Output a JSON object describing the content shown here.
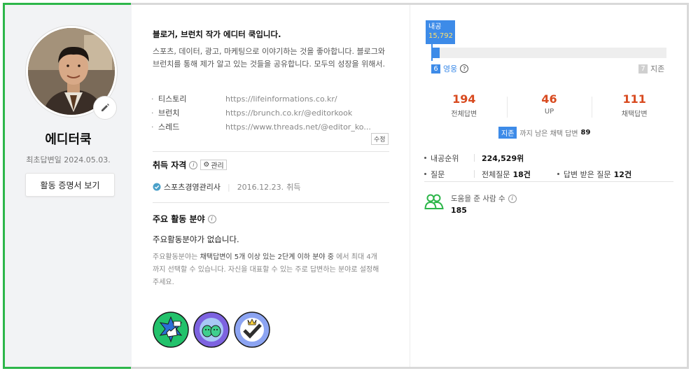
{
  "profile": {
    "nickname": "에디터쿡",
    "first_answer": "최초답변일 2024.05.03.",
    "cert_button": "활동 증명서 보기"
  },
  "bio": {
    "title": "블로거, 브런치 작가 에디터 쿡입니다.",
    "text": "스포츠, 데이터, 광고, 마케팅으로 이야기하는 것을 좋아합니다. 블로그와 브런치를 통해 제가 알고 있는 것들을 공유합니다. 모두의 성장을 위해서."
  },
  "links": [
    {
      "label": "티스토리",
      "url": "https://lifeinformations.co.kr/"
    },
    {
      "label": "브런치",
      "url": "https://brunch.co.kr/@editorkook"
    },
    {
      "label": "스레드",
      "url": "https://www.threads.net/@editor_ko..."
    }
  ],
  "edit_label": "수정",
  "qualification": {
    "title": "취득 자격",
    "manage": "관리",
    "name": "스포츠경영관리사",
    "date": "2016.12.23.",
    "status": "취득"
  },
  "area": {
    "title": "주요 활동 분야",
    "empty": "주요활동분야가 없습니다.",
    "help_pre": "주요활동분야는 ",
    "help_em": "채택답변이 5개 이상 있는 2단계 이하 분야 중",
    "help_post": " 에서 최대 4개까지 선택할 수 있습니다. 자신을 대표할 수 있는 주로 답변하는 분야로 설정해주세요."
  },
  "rank": {
    "flag_label": "내공",
    "flag_value": "15,792",
    "progress": 0.035,
    "current_level": "6",
    "current_name": "영웅",
    "next_level": "7",
    "next_name": "지존"
  },
  "stats": [
    {
      "value": "194",
      "label": "전체답변"
    },
    {
      "value": "46",
      "label": "UP"
    },
    {
      "value": "111",
      "label": "채택답변"
    }
  ],
  "remain": {
    "tag": "지존",
    "text": "까지 남은 채택 답변",
    "value": "89"
  },
  "info": {
    "rank_label": "내공순위",
    "rank_value": "224,529위",
    "question_label": "질문",
    "question_total_label": "전체질문",
    "question_total_value": "18건",
    "answered_label": "답변 받은 질문",
    "answered_value": "12건"
  },
  "helped": {
    "label": "도움을 준 사람 수",
    "value": "185"
  },
  "colors": {
    "green_frame": "#2db64a",
    "accent_blue": "#3d8be8",
    "stat_orange": "#d84a1f"
  }
}
